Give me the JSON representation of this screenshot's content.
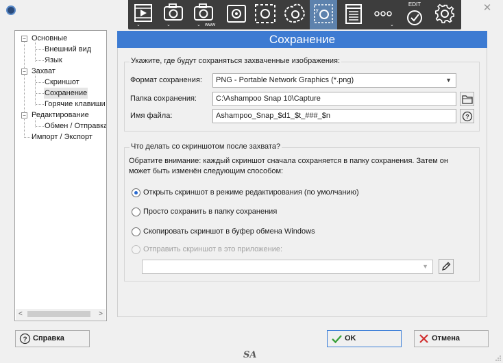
{
  "window": {
    "close_glyph": "✕"
  },
  "toolbar": {
    "tools": [
      {
        "name": "video-capture",
        "icon": "play-film-icon"
      },
      {
        "name": "capture-camera",
        "icon": "camera-icon"
      },
      {
        "name": "capture-www",
        "icon": "camera-www-icon",
        "sub_label": "www"
      },
      {
        "name": "capture-region",
        "icon": "region-camera-icon"
      },
      {
        "name": "capture-dashed",
        "icon": "dashed-region-icon"
      },
      {
        "name": "capture-freehand",
        "icon": "freehand-region-icon"
      },
      {
        "name": "capture-fixed",
        "icon": "fixed-region-icon",
        "active": true
      },
      {
        "name": "capture-document",
        "icon": "document-icon"
      },
      {
        "name": "more",
        "icon": "more-icon"
      },
      {
        "name": "edit",
        "icon": "edit-check-icon",
        "caption": "EDIT"
      },
      {
        "name": "settings",
        "icon": "gear-icon"
      }
    ]
  },
  "tree": {
    "items": [
      {
        "label": "Основные",
        "level": 0,
        "expander": "minus"
      },
      {
        "label": "Внешний вид",
        "level": 1
      },
      {
        "label": "Язык",
        "level": 1
      },
      {
        "label": "Захват",
        "level": 0,
        "expander": "minus"
      },
      {
        "label": "Скриншот",
        "level": 1
      },
      {
        "label": "Сохранение",
        "level": 1,
        "selected": true
      },
      {
        "label": "Горячие клавиши",
        "level": 1
      },
      {
        "label": "Редактирование",
        "level": 0,
        "expander": "minus"
      },
      {
        "label": "Обмен / Отправка",
        "level": 1
      },
      {
        "label": "Импорт / Экспорт",
        "level": 0
      }
    ]
  },
  "page": {
    "title": "Сохранение"
  },
  "save_group": {
    "legend": "Укажите, где будут сохраняться захваченные изображения:",
    "format_label": "Формат сохранения:",
    "format_value": "PNG - Portable Network Graphics (*.png)",
    "folder_label": "Папка сохранения:",
    "folder_value": "C:\\Ashampoo Snap 10\\Capture",
    "filename_label": "Имя файла:",
    "filename_value": "Ashampoo_Snap_$d1_$t_###_$n"
  },
  "after_group": {
    "legend": "Что делать со скриншотом после захвата?",
    "note": "Обратите внимание: каждый скриншот сначала сохраняется в папку сохранения. Затем он может быть изменён следующим способом:",
    "options": [
      {
        "label": "Открыть скриншот в режиме редактирования (по умолчанию)",
        "checked": true
      },
      {
        "label": "Просто сохранить в папку сохранения",
        "checked": false
      },
      {
        "label": "Скопировать скриншот в буфер обмена Windows",
        "checked": false
      },
      {
        "label": "Отправить скриншот в это приложение:",
        "checked": false,
        "disabled": true
      }
    ],
    "app_select_value": ""
  },
  "buttons": {
    "help": "Справка",
    "ok": "OK",
    "cancel": "Отмена"
  },
  "footer": {
    "logo_text": "SA"
  },
  "colors": {
    "accent": "#3d7bd2",
    "toolbar_bg": "#3d3d3d",
    "toolbar_active": "#5d82ad",
    "ok_check": "#3aa13a",
    "cancel_x": "#d03030"
  }
}
